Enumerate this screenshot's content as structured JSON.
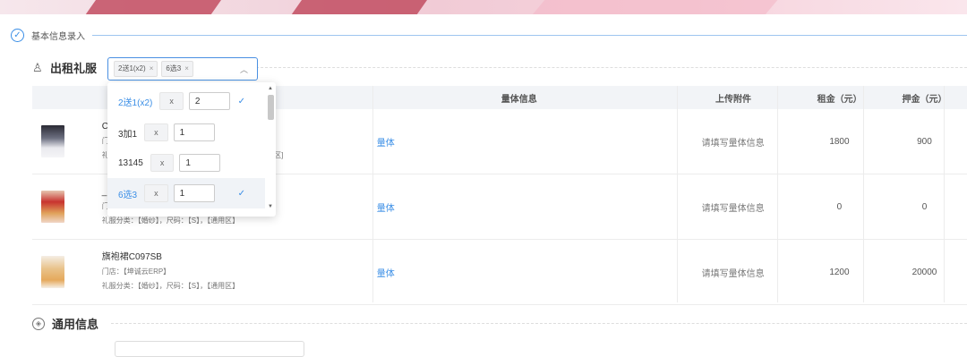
{
  "section": {
    "title": "基本信息录入"
  },
  "rental": {
    "label": "出租礼服",
    "selected_tags": [
      {
        "label": "2送1(x2)",
        "remove": "×"
      },
      {
        "label": "6选3",
        "remove": "×"
      }
    ]
  },
  "table": {
    "headers": {
      "volume": "量体信息",
      "upload": "上传附件",
      "rent": "租金（元）",
      "deposit": "押金（元）"
    },
    "rows": [
      {
        "name": "C",
        "store_line": "门",
        "category_line": "礼",
        "extra": "区1区]",
        "volume_link": "量体",
        "upload": "请填写量体信息",
        "rent": "1800",
        "deposit": "900"
      },
      {
        "name": "_",
        "store_line": "门",
        "category_line": "礼服分类：【婚纱】，尺码：【S】，【通用区】",
        "volume_link": "量体",
        "upload": "请填写量体信息",
        "rent": "0",
        "deposit": "0"
      },
      {
        "name": "旗袍裙C097SB",
        "store_line": "门店：【坤诚云ERP】",
        "category_line": "礼服分类：【婚纱】，尺码：【S】，【通用区】",
        "volume_link": "量体",
        "upload": "请填写量体信息",
        "rent": "1200",
        "deposit": "20000"
      }
    ]
  },
  "dropdown": {
    "options": [
      {
        "label": "2送1(x2)",
        "x": "x",
        "qty": "2",
        "check": "✓"
      },
      {
        "label": "3加1",
        "x": "x",
        "qty": "1",
        "check": ""
      },
      {
        "label": "13145",
        "x": "x",
        "qty": "1",
        "check": ""
      },
      {
        "label": "6选3",
        "x": "x",
        "qty": "1",
        "check": "✓"
      }
    ]
  },
  "general": {
    "label": "通用信息"
  },
  "colors": {
    "accent": "#3a8ee6"
  }
}
